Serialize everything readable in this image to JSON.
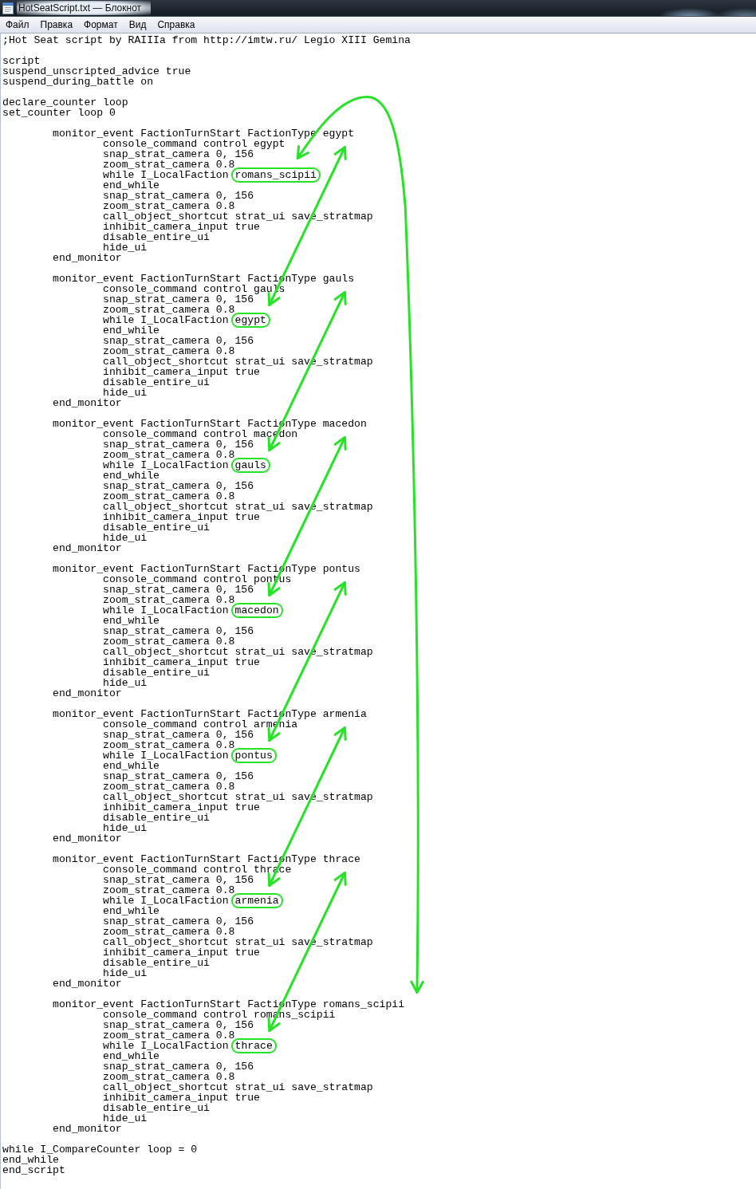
{
  "window": {
    "title": "HotSeatScript.txt — Блокнот"
  },
  "menu": [
    "Файл",
    "Правка",
    "Формат",
    "Вид",
    "Справка"
  ],
  "document": {
    "sections": [
      {
        "kind": "lines",
        "lines": [
          ";Hot Seat script by RAIIIa from http://imtw.ru/ Legio XIII Gemina"
        ]
      },
      {
        "kind": "lines",
        "lines": [
          "script",
          "suspend_unscripted_advice true",
          "suspend_during_battle on"
        ]
      },
      {
        "kind": "lines",
        "lines": [
          "declare_counter loop",
          "set_counter loop 0"
        ]
      },
      {
        "kind": "monitor",
        "header": "monitor_event FactionTurnStart FactionType egypt",
        "body": [
          {
            "text": "console_command control egypt"
          },
          {
            "text": "snap_strat_camera 0, 156"
          },
          {
            "text": "zoom_strat_camera 0.8"
          },
          {
            "text": "while I_LocalFaction",
            "circled_word": "romans_scipii"
          },
          {
            "text": "end_while"
          },
          {
            "text": "snap_strat_camera 0, 156"
          },
          {
            "text": "zoom_strat_camera 0.8"
          },
          {
            "text": "call_object_shortcut strat_ui save_stratmap"
          },
          {
            "text": "inhibit_camera_input true"
          },
          {
            "text": "disable_entire_ui"
          },
          {
            "text": "hide_ui"
          }
        ],
        "footer": "end_monitor"
      },
      {
        "kind": "monitor",
        "header": "monitor_event FactionTurnStart FactionType gauls",
        "body": [
          {
            "text": "console_command control gauls"
          },
          {
            "text": "snap_strat_camera 0, 156"
          },
          {
            "text": "zoom_strat_camera 0.8"
          },
          {
            "text": "while I_LocalFaction",
            "circled_word": "egypt"
          },
          {
            "text": "end_while"
          },
          {
            "text": "snap_strat_camera 0, 156"
          },
          {
            "text": "zoom_strat_camera 0.8"
          },
          {
            "text": "call_object_shortcut strat_ui save_stratmap"
          },
          {
            "text": "inhibit_camera_input true"
          },
          {
            "text": "disable_entire_ui"
          },
          {
            "text": "hide_ui"
          }
        ],
        "footer": "end_monitor"
      },
      {
        "kind": "monitor",
        "header": "monitor_event FactionTurnStart FactionType macedon",
        "body": [
          {
            "text": "console_command control macedon"
          },
          {
            "text": "snap_strat_camera 0, 156"
          },
          {
            "text": "zoom_strat_camera 0.8"
          },
          {
            "text": "while I_LocalFaction",
            "circled_word": "gauls"
          },
          {
            "text": "end_while"
          },
          {
            "text": "snap_strat_camera 0, 156"
          },
          {
            "text": "zoom_strat_camera 0.8"
          },
          {
            "text": "call_object_shortcut strat_ui save_stratmap"
          },
          {
            "text": "inhibit_camera_input true"
          },
          {
            "text": "disable_entire_ui"
          },
          {
            "text": "hide_ui"
          }
        ],
        "footer": "end_monitor"
      },
      {
        "kind": "monitor",
        "header": "monitor_event FactionTurnStart FactionType pontus",
        "body": [
          {
            "text": "console_command control pontus"
          },
          {
            "text": "snap_strat_camera 0, 156"
          },
          {
            "text": "zoom_strat_camera 0.8"
          },
          {
            "text": "while I_LocalFaction",
            "circled_word": "macedon"
          },
          {
            "text": "end_while"
          },
          {
            "text": "snap_strat_camera 0, 156"
          },
          {
            "text": "zoom_strat_camera 0.8"
          },
          {
            "text": "call_object_shortcut strat_ui save_stratmap"
          },
          {
            "text": "inhibit_camera_input true"
          },
          {
            "text": "disable_entire_ui"
          },
          {
            "text": "hide_ui"
          }
        ],
        "footer": "end_monitor"
      },
      {
        "kind": "monitor",
        "header": "monitor_event FactionTurnStart FactionType armenia",
        "body": [
          {
            "text": "console_command control armenia"
          },
          {
            "text": "snap_strat_camera 0, 156"
          },
          {
            "text": "zoom_strat_camera 0.8"
          },
          {
            "text": "while I_LocalFaction",
            "circled_word": "pontus"
          },
          {
            "text": "end_while"
          },
          {
            "text": "snap_strat_camera 0, 156"
          },
          {
            "text": "zoom_strat_camera 0.8"
          },
          {
            "text": "call_object_shortcut strat_ui save_stratmap"
          },
          {
            "text": "inhibit_camera_input true"
          },
          {
            "text": "disable_entire_ui"
          },
          {
            "text": "hide_ui"
          }
        ],
        "footer": "end_monitor"
      },
      {
        "kind": "monitor",
        "header": "monitor_event FactionTurnStart FactionType thrace",
        "body": [
          {
            "text": "console_command control thrace"
          },
          {
            "text": "snap_strat_camera 0, 156"
          },
          {
            "text": "zoom_strat_camera 0.8"
          },
          {
            "text": "while I_LocalFaction",
            "circled_word": "armenia"
          },
          {
            "text": "end_while"
          },
          {
            "text": "snap_strat_camera 0, 156"
          },
          {
            "text": "zoom_strat_camera 0.8"
          },
          {
            "text": "call_object_shortcut strat_ui save_stratmap"
          },
          {
            "text": "inhibit_camera_input true"
          },
          {
            "text": "disable_entire_ui"
          },
          {
            "text": "hide_ui"
          }
        ],
        "footer": "end_monitor"
      },
      {
        "kind": "monitor",
        "header": "monitor_event FactionTurnStart FactionType romans_scipii",
        "body": [
          {
            "text": "console_command control romans_scipii"
          },
          {
            "text": "snap_strat_camera 0, 156"
          },
          {
            "text": "zoom_strat_camera 0.8"
          },
          {
            "text": "while I_LocalFaction",
            "circled_word": "thrace"
          },
          {
            "text": "end_while"
          },
          {
            "text": "snap_strat_camera 0, 156"
          },
          {
            "text": "zoom_strat_camera 0.8"
          },
          {
            "text": "call_object_shortcut strat_ui save_stratmap"
          },
          {
            "text": "inhibit_camera_input true"
          },
          {
            "text": "disable_entire_ui"
          },
          {
            "text": "hide_ui"
          }
        ],
        "footer": "end_monitor"
      },
      {
        "kind": "lines",
        "lines": [
          "while I_CompareCounter loop = 0",
          "end_while",
          "end_script"
        ]
      }
    ]
  }
}
